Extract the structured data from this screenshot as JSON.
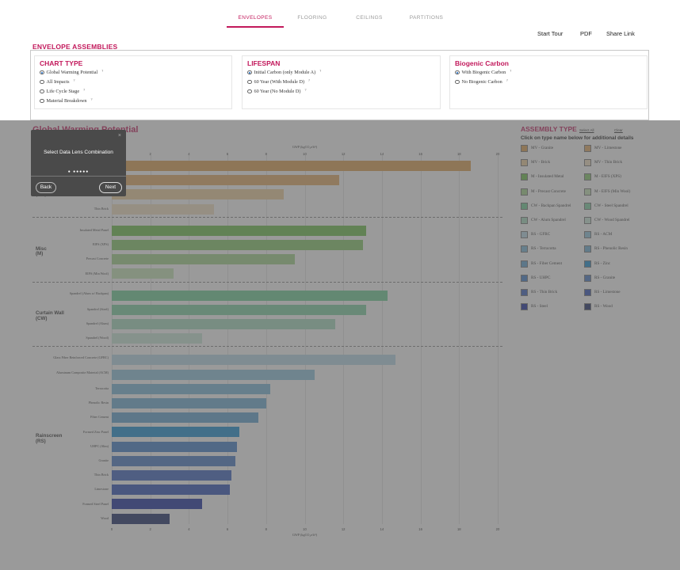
{
  "nav": {
    "tabs": [
      {
        "label": "ENVELOPES",
        "active": true
      },
      {
        "label": "FLOORING",
        "active": false
      },
      {
        "label": "CEILINGS",
        "active": false
      },
      {
        "label": "PARTITIONS",
        "active": false
      }
    ],
    "start_tour": "Start Tour",
    "pdf": "PDF",
    "share_link": "Share Link",
    "accent_color": "#c2185b"
  },
  "section_title": "ENVELOPE ASSEMBLIES",
  "options": {
    "chart_type": {
      "title": "CHART TYPE",
      "items": [
        {
          "label": "Global Warming Potential",
          "checked": true
        },
        {
          "label": "All Impacts",
          "checked": false
        },
        {
          "label": "Life Cycle Stage",
          "checked": false
        },
        {
          "label": "Material Breakdown",
          "checked": false
        }
      ]
    },
    "lifespan": {
      "title": "LIFESPAN",
      "items": [
        {
          "label": "Initial Carbon (only Module A)",
          "checked": true
        },
        {
          "label": "60 Year (With Module D)",
          "checked": false
        },
        {
          "label": "60 Year (No Module D)",
          "checked": false
        }
      ]
    },
    "biogenic": {
      "title": "Biogenic Carbon",
      "items": [
        {
          "label": "With Biogenic Carbon",
          "checked": true
        },
        {
          "label": "No Biogenic Carbon",
          "checked": false
        }
      ]
    },
    "help_mark": "?"
  },
  "tour": {
    "text": "Select Data Lens Combination",
    "dots": "● ●●●●●",
    "back": "Back",
    "next": "Next",
    "close": "×"
  },
  "legend": {
    "title": "ASSEMBLY TYPE",
    "select_all": "Select All",
    "clear": "Clear",
    "subtitle": "Click on type name below for additional details",
    "items": [
      {
        "label": "MV - Granite",
        "color": "#e0a050"
      },
      {
        "label": "MV - Limestone",
        "color": "#e4ac64"
      },
      {
        "label": "MV - Brick",
        "color": "#efcf9b"
      },
      {
        "label": "MV - Thin Brick",
        "color": "#f4e2c2"
      },
      {
        "label": "M - Insulated Metal",
        "color": "#6cc04a"
      },
      {
        "label": "M - EIFS (XPS)",
        "color": "#86cb6a"
      },
      {
        "label": "M - Precast Concrete",
        "color": "#a4d58d"
      },
      {
        "label": "M - EIFS (Min Wool)",
        "color": "#c8e6b7"
      },
      {
        "label": "CW - Backpan Spandrel",
        "color": "#6fcf97"
      },
      {
        "label": "CW - Steel Spandrel",
        "color": "#7fd3a2"
      },
      {
        "label": "CW - Alum Spandrel",
        "color": "#a6ddc0"
      },
      {
        "label": "CW - Wood Spandrel",
        "color": "#cbe9d9"
      },
      {
        "label": "RS - GFRC",
        "color": "#b7dbe9"
      },
      {
        "label": "RS - ACM",
        "color": "#8fc6e0"
      },
      {
        "label": "RS - Terracotta",
        "color": "#7ab7d9"
      },
      {
        "label": "RS - Phenolic Resin",
        "color": "#6caed6"
      },
      {
        "label": "RS - Fiber Cement",
        "color": "#5fa3d3"
      },
      {
        "label": "RS - Zinc",
        "color": "#1a8fd1"
      },
      {
        "label": "RS - UHPC",
        "color": "#3f7fcb"
      },
      {
        "label": "RS - Granite",
        "color": "#4879c4"
      },
      {
        "label": "RS - Thin Brick",
        "color": "#3a63bf"
      },
      {
        "label": "RS - Limestone",
        "color": "#2f4fb8"
      },
      {
        "label": "RS - Steel",
        "color": "#1a2b9e"
      },
      {
        "label": "RS - Wood",
        "color": "#1b2a66"
      }
    ]
  },
  "chart_data": {
    "type": "bar",
    "orientation": "horizontal",
    "title": "Global Warming Potential",
    "xlabel": "GWP (kgCO₂e/ft²)",
    "xlim": [
      0,
      20
    ],
    "x_ticks": [
      0,
      2,
      4,
      6,
      8,
      10,
      12,
      14,
      16,
      18,
      20
    ],
    "groups": [
      {
        "name": "Masonry Veneer (MV)",
        "bars": [
          {
            "label": "Granite",
            "value": 18.6,
            "color": "#e0a050"
          },
          {
            "label": "Limestone",
            "value": 11.8,
            "color": "#e4ac64"
          },
          {
            "label": "Brick",
            "value": 8.9,
            "color": "#efcf9b"
          },
          {
            "label": "Thin Brick",
            "value": 5.3,
            "color": "#f4e2c2"
          }
        ]
      },
      {
        "name": "Misc (M)",
        "bars": [
          {
            "label": "Insulated Metal Panel",
            "value": 13.2,
            "color": "#6cc04a"
          },
          {
            "label": "EIFS (XPS)",
            "value": 13.0,
            "color": "#86cb6a"
          },
          {
            "label": "Precast Concrete",
            "value": 9.5,
            "color": "#a4d58d"
          },
          {
            "label": "EIFS (Min Wool)",
            "value": 3.2,
            "color": "#c8e6b7"
          }
        ]
      },
      {
        "name": "Curtain Wall (CW)",
        "bars": [
          {
            "label": "Spandrel (Alum w/ Backpan)",
            "value": 14.3,
            "color": "#6fcf97"
          },
          {
            "label": "Spandrel (Steel)",
            "value": 13.2,
            "color": "#7fd3a2"
          },
          {
            "label": "Spandrel (Alum)",
            "value": 11.6,
            "color": "#a6ddc0"
          },
          {
            "label": "Spandrel (Wood)",
            "value": 4.7,
            "color": "#cbe9d9"
          }
        ]
      },
      {
        "name": "Rainscreen (RS)",
        "bars": [
          {
            "label": "Glass Fiber Reinforced Concrete (GFRC)",
            "value": 14.7,
            "color": "#b7dbe9"
          },
          {
            "label": "Aluminum Composite Material (ACM)",
            "value": 10.5,
            "color": "#8fc6e0"
          },
          {
            "label": "Terracotta",
            "value": 8.2,
            "color": "#7ab7d9"
          },
          {
            "label": "Phenolic Resin",
            "value": 8.0,
            "color": "#6caed6"
          },
          {
            "label": "Fiber Cement",
            "value": 7.6,
            "color": "#5fa3d3"
          },
          {
            "label": "Formed Zinc Panel",
            "value": 6.6,
            "color": "#1a8fd1"
          },
          {
            "label": "UHPC (Slim)",
            "value": 6.5,
            "color": "#3f7fcb"
          },
          {
            "label": "Granite",
            "value": 6.4,
            "color": "#4879c4"
          },
          {
            "label": "Thin Brick",
            "value": 6.2,
            "color": "#3a63bf"
          },
          {
            "label": "Limestone",
            "value": 6.1,
            "color": "#2f4fb8"
          },
          {
            "label": "Formed Steel Panel",
            "value": 4.7,
            "color": "#1a2b9e"
          },
          {
            "label": "Wood",
            "value": 3.0,
            "color": "#1b2a66"
          }
        ]
      }
    ],
    "grid": true,
    "legend_position": "right"
  }
}
